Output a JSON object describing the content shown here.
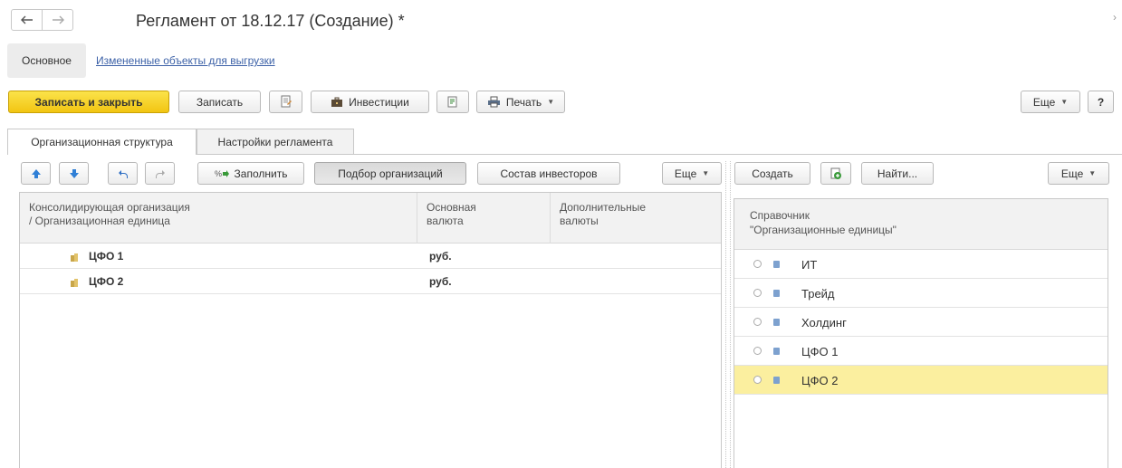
{
  "window": {
    "title": "Регламент от 18.12.17 (Создание) *",
    "corner_icon": "chevron-right-icon"
  },
  "nav": {
    "back_icon": "arrow-left-icon",
    "forward_icon": "arrow-right-icon"
  },
  "sections": {
    "main": "Основное",
    "changed_link": "Измененные объекты для выгрузки"
  },
  "toolbar": {
    "save_close": "Записать и закрыть",
    "save": "Записать",
    "investments": "Инвестиции",
    "print": "Печать",
    "more": "Еще",
    "help": "?"
  },
  "tabs": [
    {
      "label": "Организационная структура",
      "active": true
    },
    {
      "label": "Настройки регламента",
      "active": false
    }
  ],
  "left_toolbar": {
    "fill": "Заполнить",
    "select_orgs": "Подбор организаций",
    "investors": "Состав инвесторов",
    "more": "Еще"
  },
  "left_table": {
    "columns": [
      "Консолидирующая организация\n/ Организационная единица",
      "Основная\nвалюта",
      "Дополнительные\nвалюты"
    ],
    "rows": [
      {
        "name": "ЦФО 1",
        "currency": "руб.",
        "extra": ""
      },
      {
        "name": "ЦФО 2",
        "currency": "руб.",
        "extra": ""
      }
    ]
  },
  "right_toolbar": {
    "create": "Создать",
    "find": "Найти...",
    "more": "Еще"
  },
  "right_list": {
    "header": "Справочник\n\"Организационные единицы\"",
    "items": [
      {
        "label": "ИТ",
        "selected": false
      },
      {
        "label": "Трейд",
        "selected": false
      },
      {
        "label": "Холдинг",
        "selected": false
      },
      {
        "label": "ЦФО 1",
        "selected": false
      },
      {
        "label": "ЦФО 2",
        "selected": true
      }
    ]
  },
  "colors": {
    "accent_yellow": "#f5d21f",
    "link_blue": "#3d62a8",
    "selection": "#fbef9f",
    "arrow_blue": "#2f7fd6"
  }
}
